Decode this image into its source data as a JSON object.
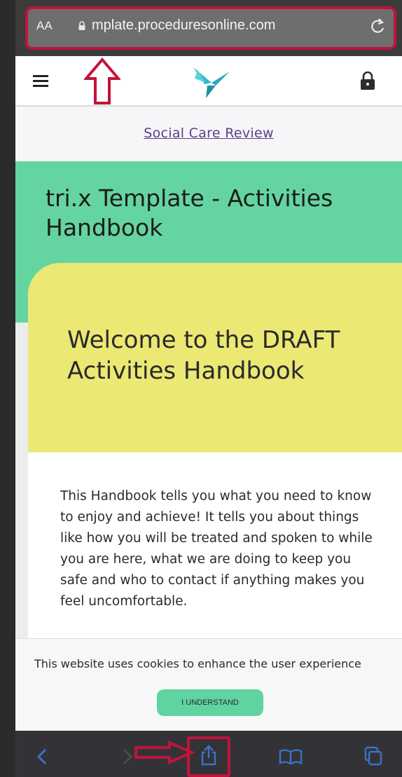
{
  "browser": {
    "text_size_label": "AA",
    "url": "mplate.proceduresonline.com",
    "reload_icon": "reload-icon",
    "lock_icon": "lock-icon"
  },
  "site_header": {
    "menu_icon": "hamburger-icon",
    "logo": "trix-logo",
    "padlock_icon": "padlock-icon"
  },
  "breadcrumb": {
    "link_text": "Social Care Review"
  },
  "page": {
    "title": "tri.x Template - Activities Handbook"
  },
  "card": {
    "title": "Welcome to the DRAFT Activities Handbook",
    "body": "This Handbook tells you what you need to know to enjoy and achieve! It tells you about things like how you will be treated and spoken to while you are here, what we are doing to keep you safe and who to contact if anything makes you feel uncomfortable."
  },
  "cookie_banner": {
    "text": "This website uses cookies to enhance the user experience",
    "button_label": "I UNDERSTAND"
  },
  "toolbar": {
    "icons": [
      "back-icon",
      "forward-icon",
      "share-icon",
      "bookmarks-icon",
      "tabs-icon"
    ]
  },
  "colors": {
    "highlight": "#c0143c",
    "title_band": "#64d5a0",
    "card_head": "#ebe874",
    "link": "#5a3f8a",
    "cookie_button": "#5fd3a0",
    "logo_teal": "#27b7c4"
  }
}
